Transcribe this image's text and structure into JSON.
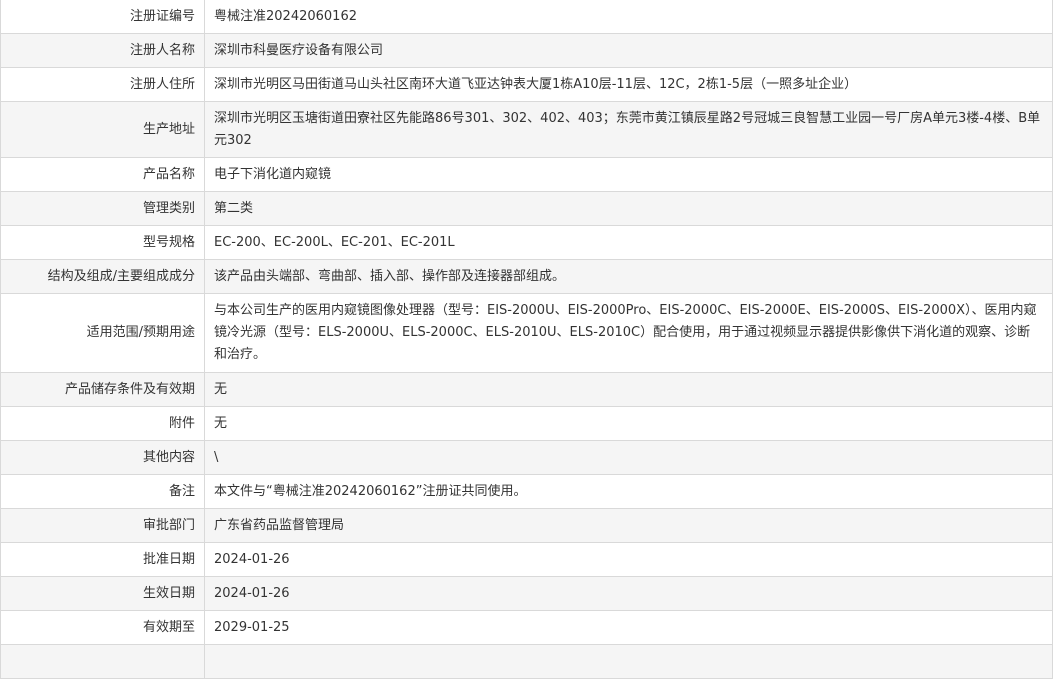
{
  "rows": [
    {
      "label": "注册证编号",
      "value": "粤械注准20242060162"
    },
    {
      "label": "注册人名称",
      "value": "深圳市科曼医疗设备有限公司"
    },
    {
      "label": "注册人住所",
      "value": "深圳市光明区马田街道马山头社区南环大道飞亚达钟表大厦1栋A10层-11层、12C，2栋1-5层（一照多址企业）"
    },
    {
      "label": "生产地址",
      "value": "深圳市光明区玉塘街道田寮社区先能路86号301、302、402、403；东莞市黄江镇辰星路2号冠城三良智慧工业园一号厂房A单元3楼-4楼、B单元302"
    },
    {
      "label": "产品名称",
      "value": "电子下消化道内窥镜"
    },
    {
      "label": "管理类别",
      "value": "第二类"
    },
    {
      "label": "型号规格",
      "value": "EC-200、EC-200L、EC-201、EC-201L"
    },
    {
      "label": "结构及组成/主要组成成分",
      "value": "该产品由头端部、弯曲部、插入部、操作部及连接器部组成。"
    },
    {
      "label": "适用范围/预期用途",
      "value": "与本公司生产的医用内窥镜图像处理器（型号：EIS-2000U、EIS-2000Pro、EIS-2000C、EIS-2000E、EIS-2000S、EIS-2000X）、医用内窥镜冷光源（型号：ELS-2000U、ELS-2000C、ELS-2010U、ELS-2010C）配合使用，用于通过视频显示器提供影像供下消化道的观察、诊断和治疗。"
    },
    {
      "label": "产品储存条件及有效期",
      "value": "无"
    },
    {
      "label": "附件",
      "value": "无"
    },
    {
      "label": "其他内容",
      "value": "\\"
    },
    {
      "label": "备注",
      "value": "本文件与“粤械注准20242060162”注册证共同使用。"
    },
    {
      "label": "审批部门",
      "value": "广东省药品监督管理局"
    },
    {
      "label": "批准日期",
      "value": "2024-01-26"
    },
    {
      "label": "生效日期",
      "value": "2024-01-26"
    },
    {
      "label": "有效期至",
      "value": "2029-01-25"
    }
  ]
}
